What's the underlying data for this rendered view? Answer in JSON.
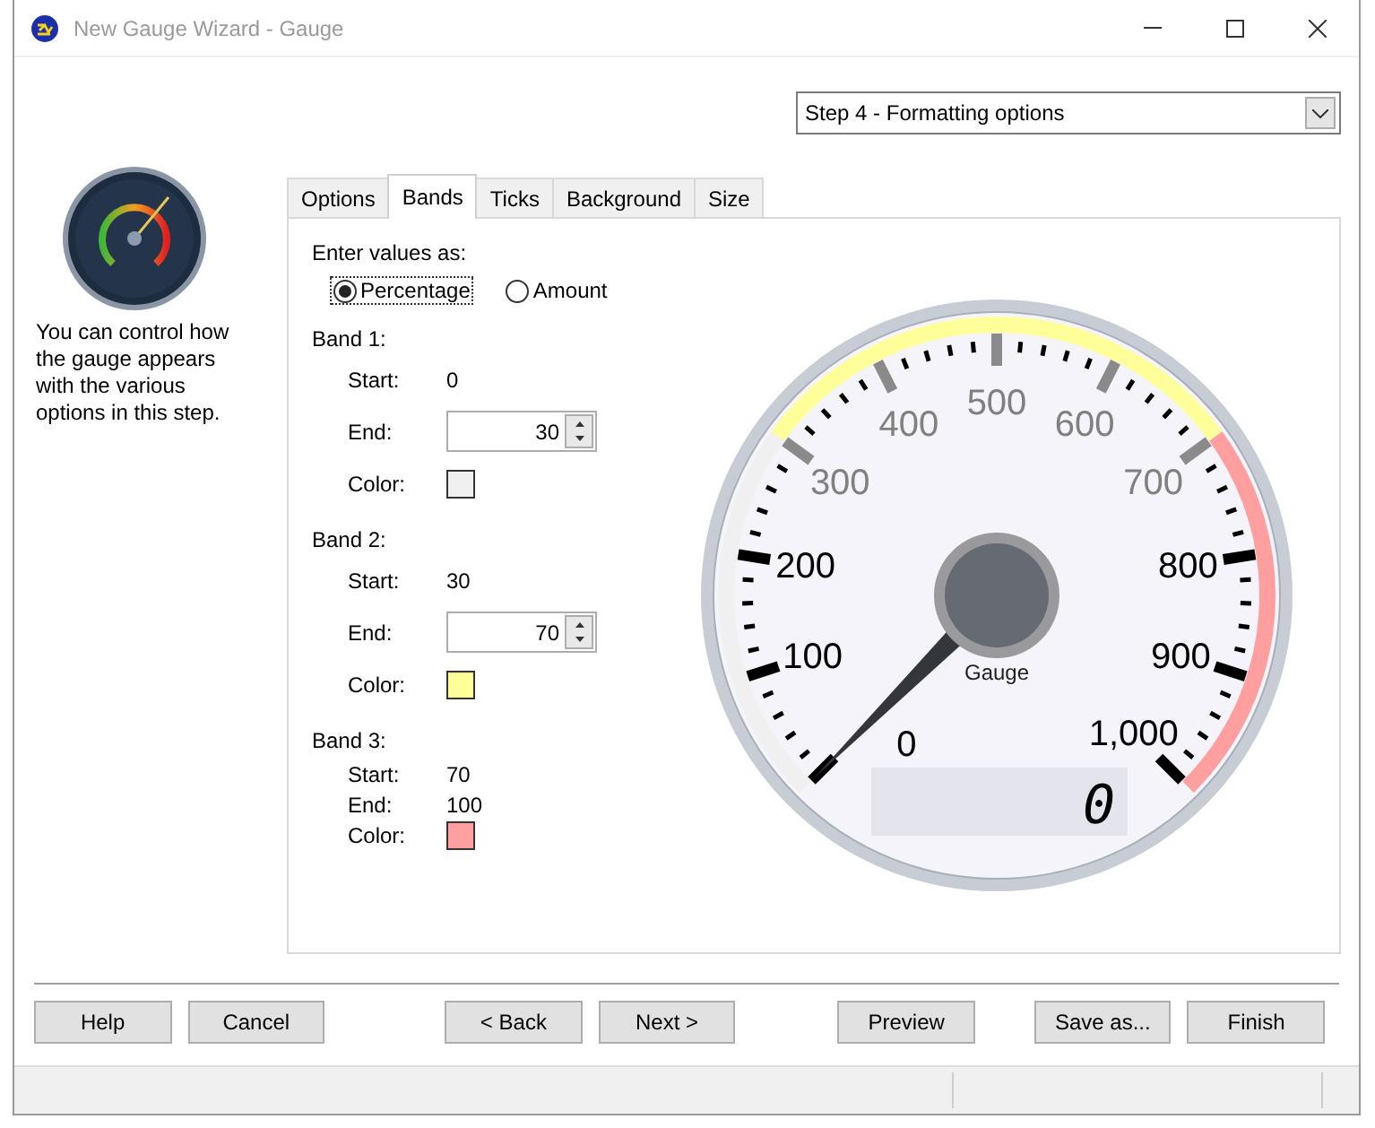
{
  "window": {
    "title": "New Gauge Wizard - Gauge"
  },
  "step_selector": {
    "value": "Step 4 - Formatting options"
  },
  "description": "You can control how the gauge appears with the various options in this step.",
  "tabs": [
    {
      "label": "Options",
      "selected": false
    },
    {
      "label": "Bands",
      "selected": true
    },
    {
      "label": "Ticks",
      "selected": false
    },
    {
      "label": "Background",
      "selected": false
    },
    {
      "label": "Size",
      "selected": false
    }
  ],
  "enter_values": {
    "label": "Enter values as:",
    "options": [
      {
        "label": "Percentage",
        "selected": true,
        "focused": true
      },
      {
        "label": "Amount",
        "selected": false,
        "focused": false
      }
    ]
  },
  "bands": [
    {
      "title": "Band 1:",
      "start_label": "Start:",
      "start": "0",
      "end_label": "End:",
      "end": "30",
      "kind": "editable",
      "color_label": "Color:",
      "color": "#f0f0f0"
    },
    {
      "title": "Band 2:",
      "start_label": "Start:",
      "start": "30",
      "end_label": "End:",
      "end": "70",
      "kind": "editable",
      "color_label": "Color:",
      "color": "#ffff99"
    },
    {
      "title": "Band 3:",
      "start_label": "Start:",
      "start": "70",
      "end_label": "End:",
      "end": "100",
      "kind": "fixed",
      "color_label": "Color:",
      "color": "#ff9f9f"
    }
  ],
  "gauge": {
    "scale_labels": [
      "0",
      "100",
      "200",
      "300",
      "400",
      "500",
      "600",
      "700",
      "800",
      "900",
      "1,000"
    ],
    "caption": "Gauge",
    "readout": "0"
  },
  "buttons": [
    "Help",
    "Cancel",
    "< Back",
    "Next >",
    "Preview",
    "Save as...",
    "Finish"
  ]
}
